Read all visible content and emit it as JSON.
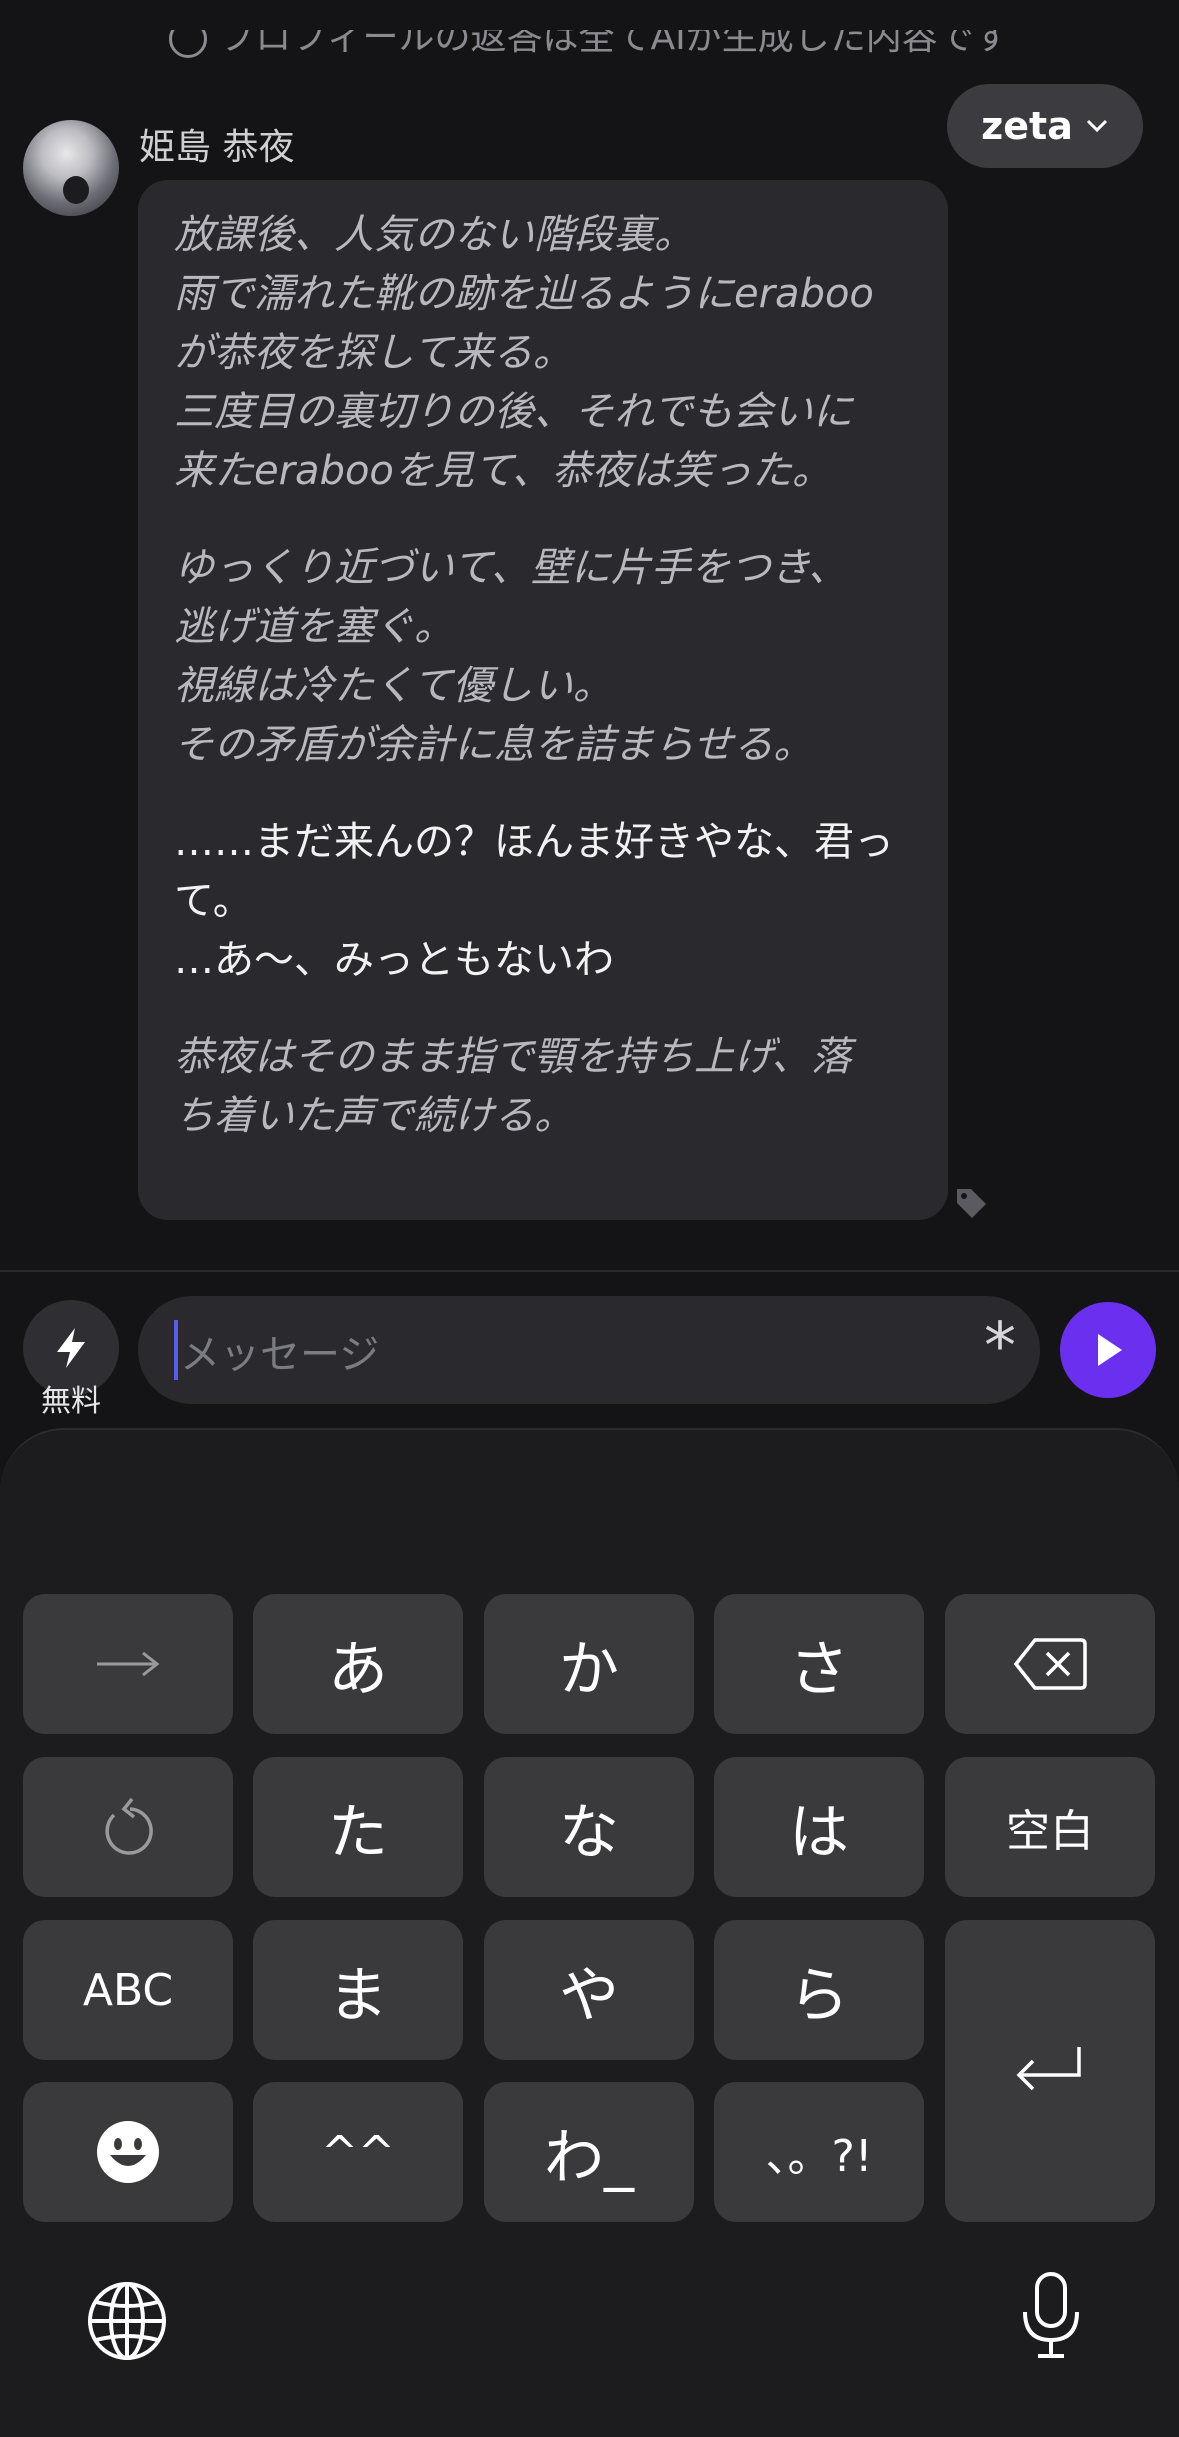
{
  "notice": {
    "text": "プロフィールの返答は全てAIが生成した内容です"
  },
  "model": {
    "label": "zeta",
    "chevron": "chevron-down-icon"
  },
  "character": {
    "name": "姫島 恭夜"
  },
  "message": {
    "lines": [
      {
        "text": "放課後、人気のない階段裏。",
        "style": "narr"
      },
      {
        "text": "雨で濡れた靴の跡を辿るようにeraboo",
        "style": "narr"
      },
      {
        "text": "が恭夜を探して来る。",
        "style": "narr"
      },
      {
        "text": "三度目の裏切りの後、それでも会いに",
        "style": "narr"
      },
      {
        "text": "来たerabooを見て、恭夜は笑った。",
        "style": "narr"
      },
      {
        "text": "",
        "style": "gap"
      },
      {
        "text": "ゆっくり近づいて、壁に片手をつき、",
        "style": "narr"
      },
      {
        "text": "逃げ道を塞ぐ。",
        "style": "narr"
      },
      {
        "text": "視線は冷たくて優しい。",
        "style": "narr"
      },
      {
        "text": "その矛盾が余計に息を詰まらせる。",
        "style": "narr"
      },
      {
        "text": "",
        "style": "gap"
      },
      {
        "text": "……まだ来んの？ほんま好きやな、君っ",
        "style": "speech"
      },
      {
        "text": "て。",
        "style": "speech"
      },
      {
        "text": "…あ〜、みっともないわ",
        "style": "speech"
      },
      {
        "text": "",
        "style": "gap"
      },
      {
        "text": "恭夜はそのまま指で顎を持ち上げ、落",
        "style": "narr"
      },
      {
        "text": "ち着いた声で続ける。",
        "style": "narr"
      }
    ]
  },
  "composer": {
    "free_label": "無料",
    "placeholder": "メッセージ",
    "asterisk": "*"
  },
  "keyboard": {
    "keys": [
      "→",
      "あ",
      "か",
      "さ",
      "⌫",
      "↺",
      "た",
      "な",
      "は",
      "空白",
      "ABC",
      "ま",
      "や",
      "ら",
      "⏎",
      "☻",
      "^^",
      "わ_",
      "、。?!"
    ]
  },
  "colors": {
    "accent": "#6b2ff0",
    "caret": "#5b5bf0",
    "bubble": "#2a2a2e",
    "background": "#141416"
  }
}
